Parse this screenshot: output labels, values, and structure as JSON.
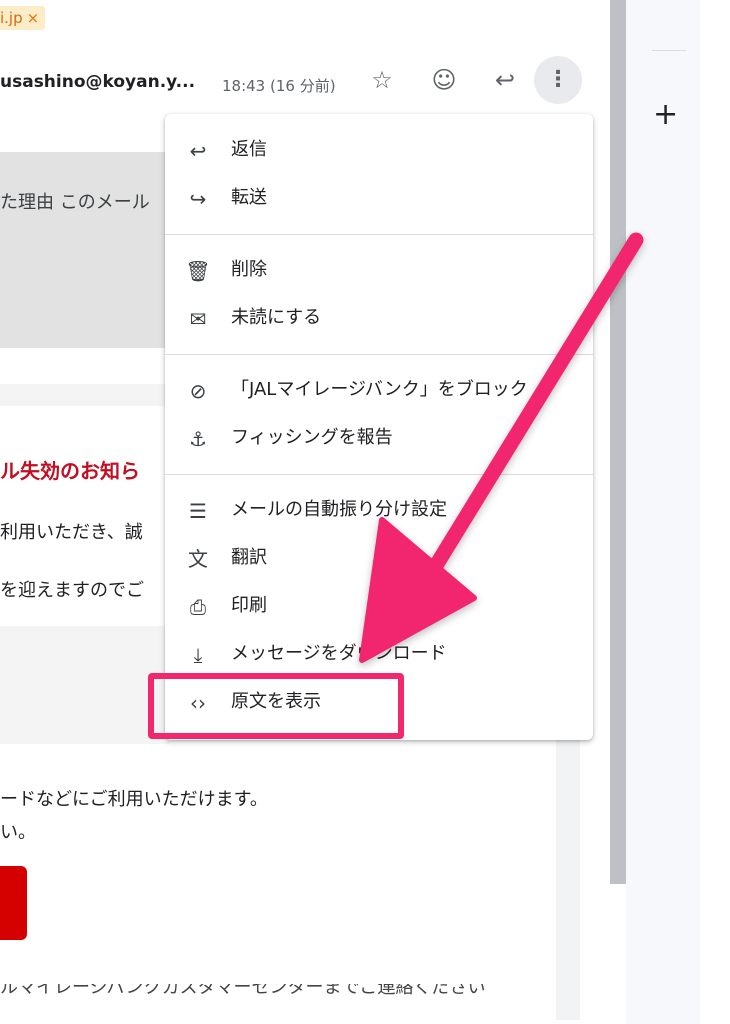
{
  "email": {
    "tag_text": "i.jp",
    "tag_close": "×",
    "sender": "usashino@koyan.y...",
    "time": "18:43 (16 分前)",
    "gray_text": "た理由 このメール",
    "red_heading": "ル失効のお知ら",
    "line_1": "利用いただき、誠",
    "line_2": "を迎えますのでご",
    "line_3": "ードなどにご利用いただけます。",
    "line_4": "い。",
    "cut_line": "ルマイレージバンクカスタマーセンターまでご連絡ください"
  },
  "header_icons": {
    "star": "☆",
    "emoji": "☺",
    "reply": "↩",
    "more": "⋮"
  },
  "menu": {
    "items": [
      {
        "icon": "↩",
        "label": "返信"
      },
      {
        "icon": "↪",
        "label": "転送"
      },
      {
        "icon": "🗑",
        "label": "削除"
      },
      {
        "icon": "✉",
        "label": "未読にする"
      },
      {
        "icon": "⊘",
        "label": "「JALマイレージバンク」をブロック"
      },
      {
        "icon": "⚓",
        "label": "フィッシングを報告"
      },
      {
        "icon": "☰",
        "label": "メールの自動振り分け設定"
      },
      {
        "icon": "文",
        "label": "翻訳"
      },
      {
        "icon": "⎙",
        "label": "印刷"
      },
      {
        "icon": "⤓",
        "label": "メッセージをダウンロード"
      },
      {
        "icon": "‹›",
        "label": "原文を表示"
      }
    ]
  },
  "side_panel": {
    "plus": "+"
  },
  "colors": {
    "accent_arrow": "#f2286e",
    "heading_red": "#c30d23",
    "button_red": "#d50000"
  }
}
